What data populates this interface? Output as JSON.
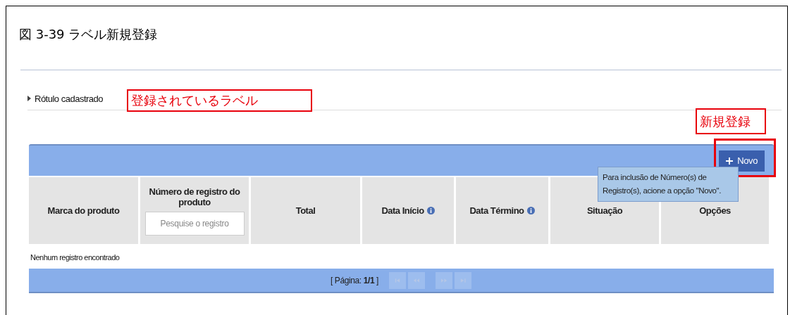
{
  "figure": {
    "title": "図 3-39 ラベル新規登録"
  },
  "section": {
    "title": "Rótulo cadastrado"
  },
  "annotations": [
    {
      "text": "登録されているラベル"
    },
    {
      "text": "新規登録"
    }
  ],
  "toolbar": {
    "new_button": {
      "label": "Novo"
    }
  },
  "tooltip": {
    "text": "Para inclusão de Número(s) de Registro(s), acione a opção \"Novo\"."
  },
  "table": {
    "columns": [
      {
        "label": "Marca do produto",
        "info": false
      },
      {
        "label": "Número de registro do produto",
        "info": false,
        "search_placeholder": "Pesquise o registro"
      },
      {
        "label": "Total",
        "info": false
      },
      {
        "label": "Data Início",
        "info": true
      },
      {
        "label": "Data Término",
        "info": true
      },
      {
        "label": "Situação",
        "info": false
      },
      {
        "label": "Opções",
        "info": false
      }
    ],
    "empty_message": "Nenhum registro encontrado"
  },
  "pager": {
    "page_label": "[ Página: **1/1** ]",
    "buttons": [
      {
        "kind": "first",
        "disabled": true
      },
      {
        "kind": "prev",
        "disabled": true
      },
      {
        "kind": "next",
        "disabled": true
      },
      {
        "kind": "last",
        "disabled": true
      }
    ]
  }
}
